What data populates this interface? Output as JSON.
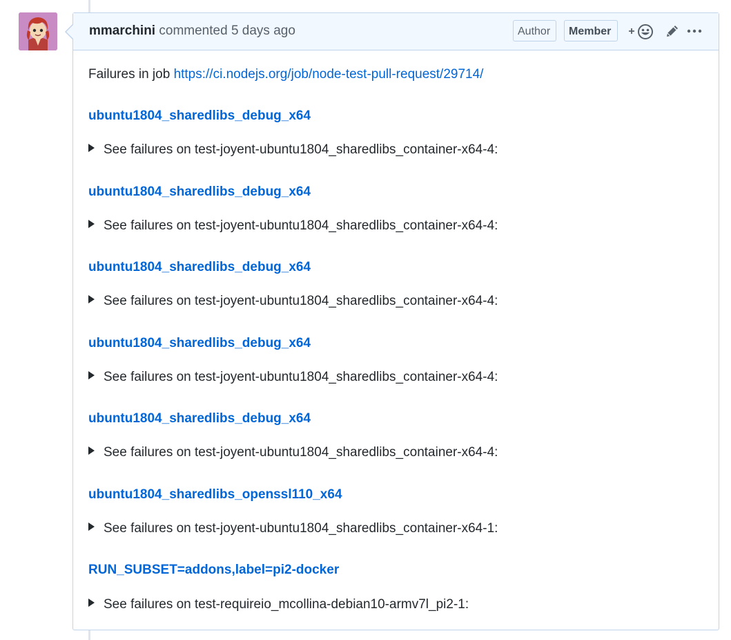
{
  "comment": {
    "author": "mmarchini",
    "action_text": "commented",
    "time_ago": "5 days ago",
    "labels": {
      "author": "Author",
      "member": "Member"
    },
    "icons": {
      "add_reaction": "add-reaction-icon",
      "edit": "pencil-icon",
      "more": "kebab-horizontal-icon"
    },
    "intro_text": "Failures in job",
    "job_url": "https://ci.nodejs.org/job/node-test-pull-request/29714/",
    "sections": [
      {
        "title": "ubuntu1804_sharedlibs_debug_x64",
        "details": "See failures on test-joyent-ubuntu1804_sharedlibs_container-x64-4:"
      },
      {
        "title": "ubuntu1804_sharedlibs_debug_x64",
        "details": "See failures on test-joyent-ubuntu1804_sharedlibs_container-x64-4:"
      },
      {
        "title": "ubuntu1804_sharedlibs_debug_x64",
        "details": "See failures on test-joyent-ubuntu1804_sharedlibs_container-x64-4:"
      },
      {
        "title": "ubuntu1804_sharedlibs_debug_x64",
        "details": "See failures on test-joyent-ubuntu1804_sharedlibs_container-x64-4:"
      },
      {
        "title": "ubuntu1804_sharedlibs_debug_x64",
        "details": "See failures on test-joyent-ubuntu1804_sharedlibs_container-x64-4:"
      },
      {
        "title": "ubuntu1804_sharedlibs_openssl110_x64",
        "details": "See failures on test-joyent-ubuntu1804_sharedlibs_container-x64-1:"
      },
      {
        "title": "RUN_SUBSET=addons,label=pi2-docker",
        "details": "See failures on test-requireio_mcollina-debian10-armv7l_pi2-1:"
      }
    ]
  },
  "colors": {
    "link": "#0366d6",
    "header_bg": "#f1f8ff",
    "header_border": "#c0d3eb",
    "text": "#24292e",
    "muted": "#586069"
  }
}
